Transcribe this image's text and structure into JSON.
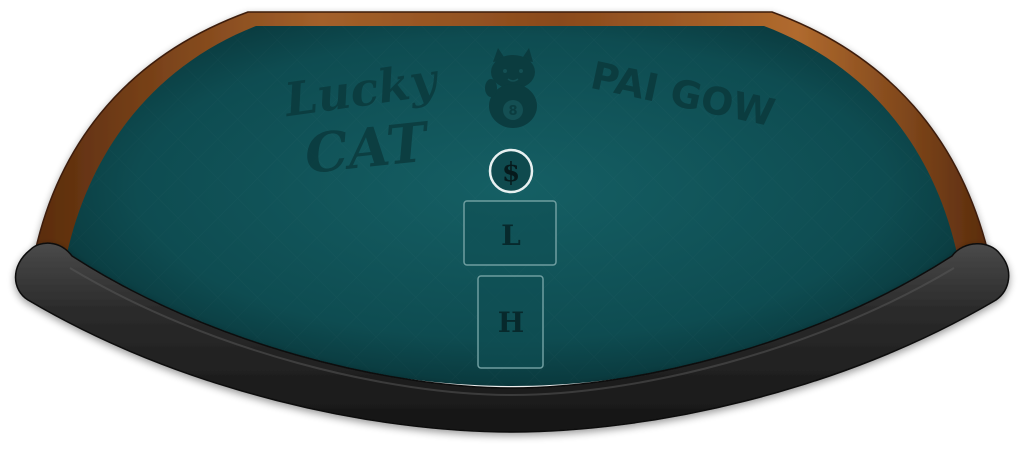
{
  "game": {
    "logo_line1": "Lucky",
    "logo_line2": "CAT",
    "title": "PAI GOW",
    "mascot_coin_number": "8"
  },
  "bet_spot": {
    "symbol": "$"
  },
  "hand_boxes": {
    "low_label": "L",
    "high_label": "H"
  },
  "colors": {
    "felt": "#0f5257",
    "felt_dark": "#0a3438",
    "rail_wood": "#8a4a1c",
    "armrest": "#2a2a2a",
    "watermark": "#0b3a3d",
    "box_border": "#6f9ea0"
  },
  "icons": {
    "mascot": "lucky-cat-icon"
  }
}
